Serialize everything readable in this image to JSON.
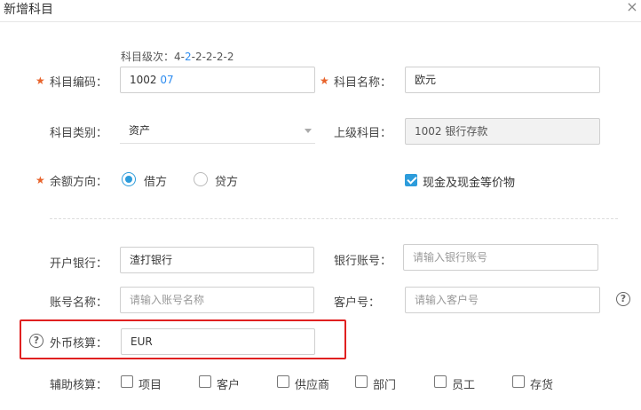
{
  "dialog": {
    "title": "新增科目",
    "close_glyph": "×"
  },
  "level_hint": {
    "prefix": "科目级次：4-",
    "highlight": "2",
    "suffix": "-2-2-2-2"
  },
  "fields": {
    "code": {
      "label": "科目编码：",
      "value_prefix": "1002",
      "value_suffix": "07",
      "required": true
    },
    "name": {
      "label": "科目名称：",
      "value": "欧元",
      "required": true
    },
    "category": {
      "label": "科目类别：",
      "value": "资产"
    },
    "parent": {
      "label": "上级科目：",
      "value": "1002 银行存款"
    },
    "balance_direction": {
      "label": "余额方向：",
      "required": true,
      "options": [
        {
          "label": "借方",
          "checked": true
        },
        {
          "label": "贷方",
          "checked": false
        }
      ]
    },
    "cash_equivalent": {
      "label": "现金及现金等价物",
      "checked": true
    },
    "bank": {
      "label": "开户银行：",
      "value": "渣打银行"
    },
    "bank_account": {
      "label": "银行账号：",
      "placeholder": "请输入银行账号"
    },
    "account_name": {
      "label": "账号名称：",
      "placeholder": "请输入账号名称"
    },
    "customer_no": {
      "label": "客户号：",
      "placeholder": "请输入客户号"
    },
    "foreign_currency": {
      "label": "外币核算：",
      "value": "EUR"
    },
    "auxiliary": {
      "label": "辅助核算：",
      "options": [
        {
          "label": "项目",
          "checked": false
        },
        {
          "label": "客户",
          "checked": false
        },
        {
          "label": "供应商",
          "checked": false
        },
        {
          "label": "部门",
          "checked": false
        },
        {
          "label": "员工",
          "checked": false
        },
        {
          "label": "存货",
          "checked": false
        }
      ]
    }
  },
  "help_glyph": "?",
  "colors": {
    "accent": "#2d9cdb",
    "required_star": "#e8632b",
    "highlight_border": "#e02020"
  }
}
